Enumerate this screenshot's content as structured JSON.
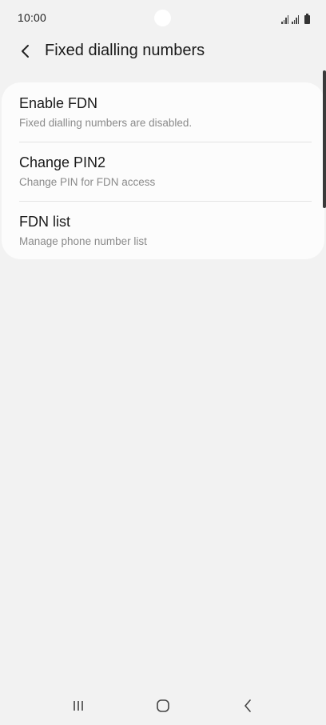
{
  "status_bar": {
    "time": "10:00"
  },
  "header": {
    "back_icon": "chevron-left-icon",
    "title": "Fixed dialling numbers"
  },
  "settings": {
    "items": [
      {
        "title": "Enable FDN",
        "subtitle": "Fixed dialling numbers are disabled."
      },
      {
        "title": "Change PIN2",
        "subtitle": "Change PIN for FDN access"
      },
      {
        "title": "FDN list",
        "subtitle": "Manage phone number list"
      }
    ]
  },
  "nav_bar": {
    "recents_icon": "recents-icon",
    "home_icon": "home-icon",
    "back_icon": "back-icon"
  },
  "colors": {
    "background": "#f2f2f2",
    "card": "#fcfcfc",
    "title_text": "#1a1a1a",
    "subtitle_text": "#8a8a8a"
  }
}
